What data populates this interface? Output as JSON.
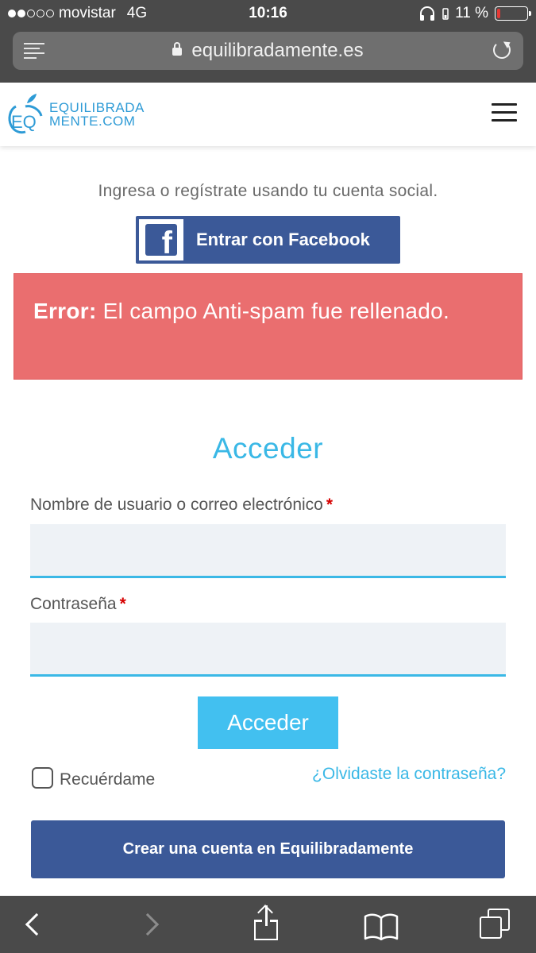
{
  "status_bar": {
    "carrier": "movistar",
    "network": "4G",
    "time": "10:16",
    "battery_text": "11 %",
    "battery_level": 0.11,
    "signal_bars_filled": 2,
    "signal_bars_total": 5
  },
  "browser": {
    "url": "equilibradamente.es"
  },
  "site": {
    "logo_mark": "EQ",
    "logo_line1": "EQUILIBRADA",
    "logo_line2": "MENTE.COM",
    "brand_color": "#2e9bd6"
  },
  "login": {
    "social_prompt": "Ingresa o regístrate usando tu cuenta social.",
    "facebook_button": "Entrar con Facebook",
    "error_prefix": "Error:",
    "error_message": " El campo Anti-spam fue rellenado.",
    "title": "Acceder",
    "username_label": "Nombre de usuario o correo electrónico",
    "username_value": "",
    "password_label": "Contraseña",
    "password_value": "",
    "required_marker": "*",
    "submit_label": "Acceder",
    "remember_label": "Recuérdame",
    "remember_checked": false,
    "forgot_link": "¿Olvidaste la contraseña?",
    "create_account": "Crear una cuenta en Equilibradamente"
  },
  "colors": {
    "facebook_blue": "#3b5998",
    "error_red": "#ea6e6f",
    "accent": "#3ab8e6",
    "required": "#d60000"
  },
  "toolbar": {
    "icons": [
      "back-icon",
      "forward-icon",
      "share-icon",
      "bookmarks-icon",
      "tabs-icon"
    ]
  }
}
